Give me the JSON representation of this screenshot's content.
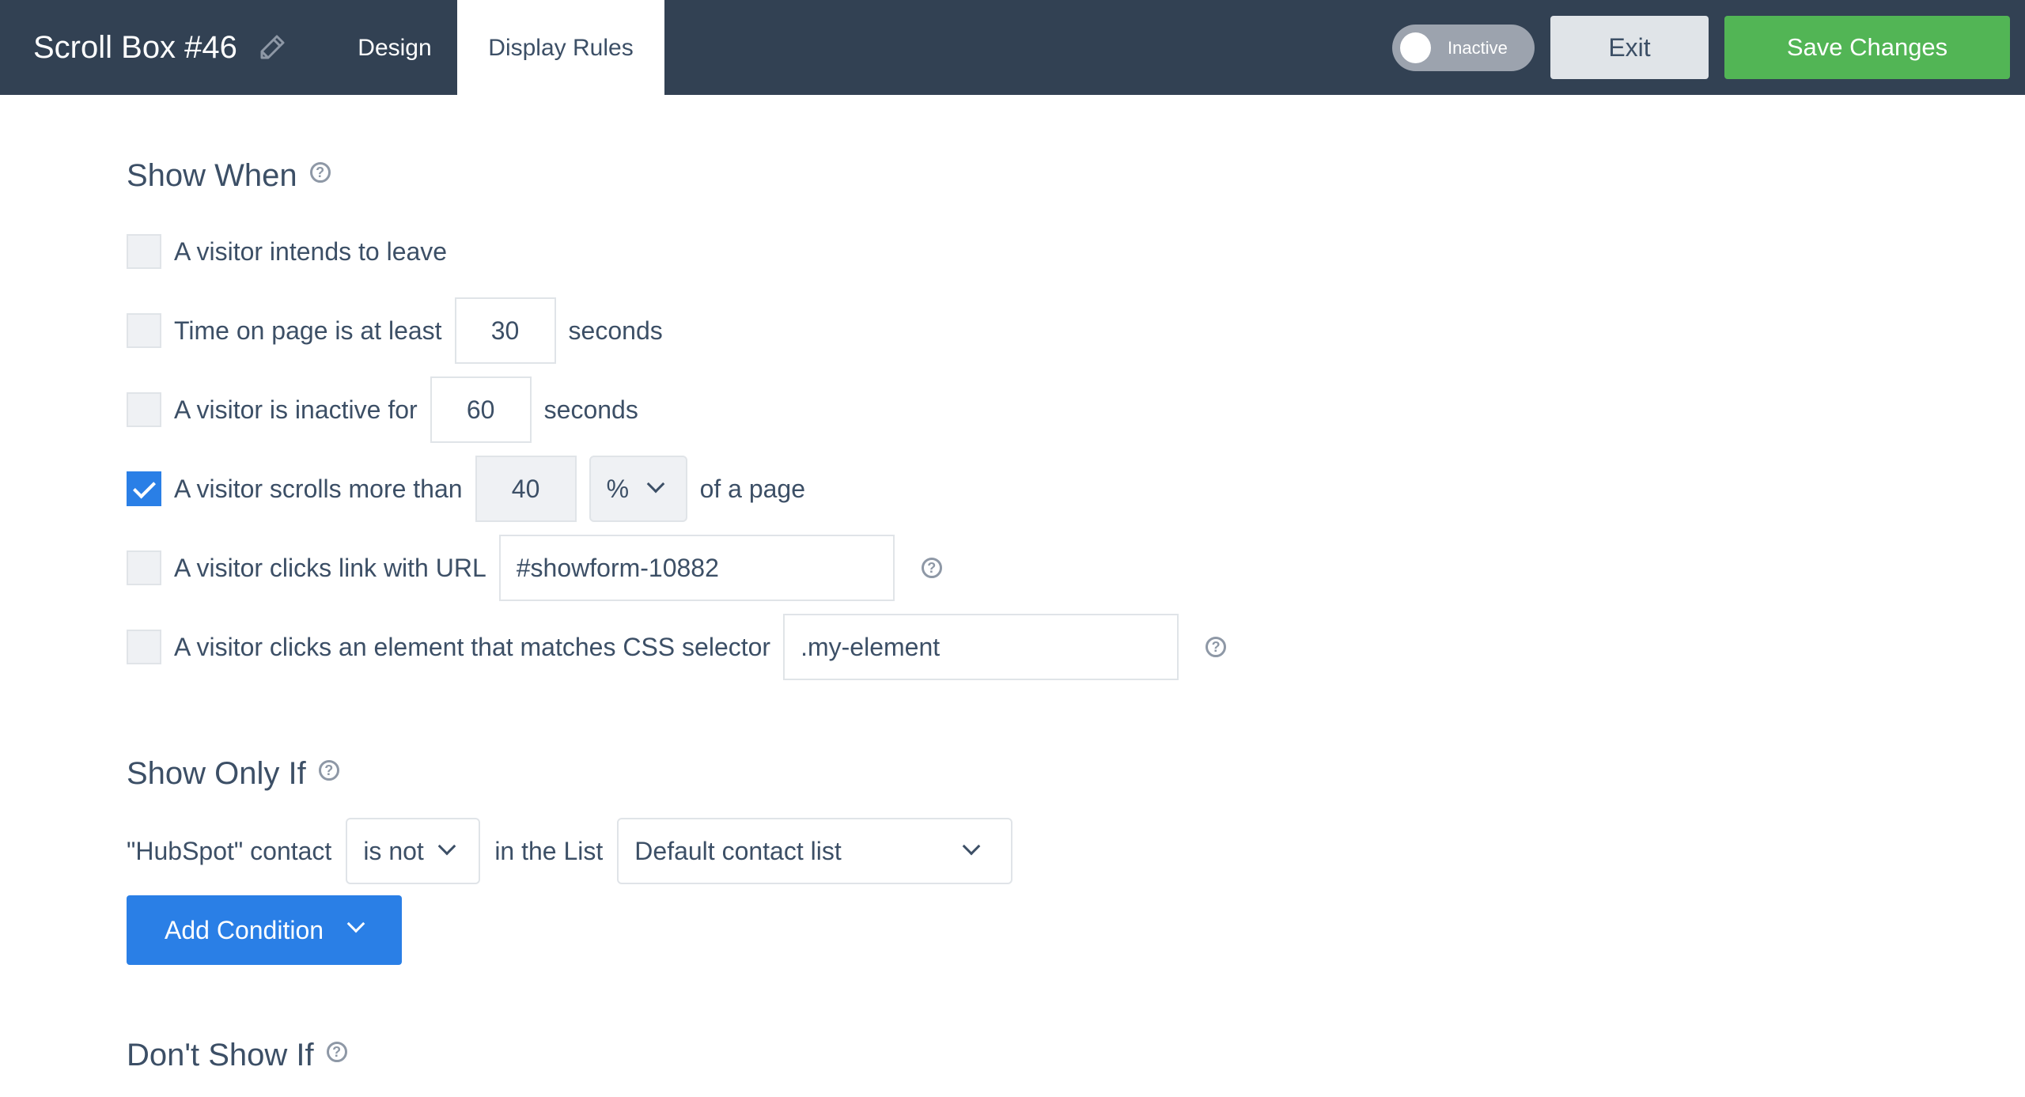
{
  "header": {
    "title": "Scroll Box #46",
    "edit_icon": "pencil-icon",
    "tabs": [
      {
        "label": "Design",
        "active": false
      },
      {
        "label": "Display Rules",
        "active": true
      }
    ],
    "toggle": {
      "label": "Inactive",
      "state": "off"
    },
    "exit_label": "Exit",
    "save_label": "Save Changes"
  },
  "show_when": {
    "title": "Show When",
    "help_icon": "question-circle-icon",
    "rules": [
      {
        "label": "A visitor intends to leave",
        "checked": false
      },
      {
        "label": "Time on page is at least",
        "value": "30",
        "suffix": "seconds",
        "checked": false
      },
      {
        "label": "A visitor is inactive for",
        "value": "60",
        "suffix": "seconds",
        "checked": false
      },
      {
        "label": "A visitor scrolls more than",
        "value": "40",
        "unit": "%",
        "suffix": "of a page",
        "checked": true
      },
      {
        "label": "A visitor clicks link with URL",
        "value": "#showform-10882",
        "checked": false
      },
      {
        "label": "A visitor clicks an element that matches CSS selector",
        "value": ".my-element",
        "checked": false
      }
    ]
  },
  "show_only_if": {
    "title": "Show Only If",
    "condition": {
      "subject": "\"HubSpot\" contact",
      "operator": "is not",
      "connector": "in the List",
      "list": "Default contact list"
    },
    "add_condition_label": "Add Condition"
  },
  "dont_show_if": {
    "title": "Don't Show If"
  },
  "colors": {
    "header_bg": "#324153",
    "accent_blue": "#2a7fe6",
    "save_green": "#52b555",
    "text": "#3c4f66"
  }
}
